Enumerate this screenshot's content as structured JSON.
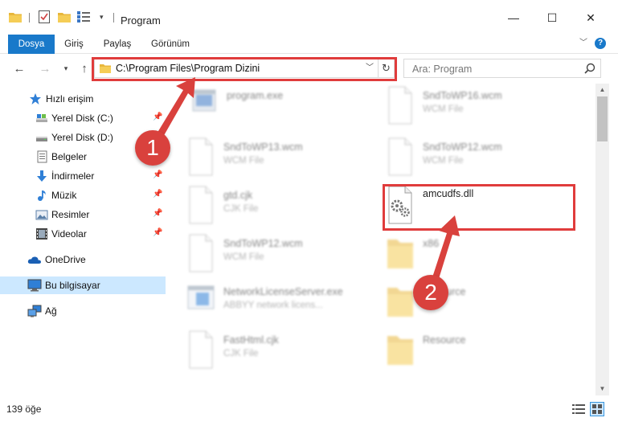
{
  "window": {
    "title": "Program",
    "minimize_glyph": "—",
    "maximize_glyph": "☐",
    "close_glyph": "✕"
  },
  "ribbon": {
    "tabs": [
      "Dosya",
      "Giriş",
      "Paylaş",
      "Görünüm"
    ],
    "help_glyph": "?"
  },
  "nav": {
    "address": "C:\\Program Files\\Program Dizini",
    "search_placeholder": "Ara: Program"
  },
  "sidebar": {
    "items": [
      {
        "label": "Hızlı erişim",
        "icon": "star-icon",
        "pinned": false
      },
      {
        "label": "Yerel Disk (C:)",
        "icon": "drive-icon",
        "pinned": true
      },
      {
        "label": "Yerel Disk (D:)",
        "icon": "drive-icon",
        "pinned": true
      },
      {
        "label": "Belgeler",
        "icon": "document-icon",
        "pinned": true
      },
      {
        "label": "İndirmeler",
        "icon": "download-icon",
        "pinned": true
      },
      {
        "label": "Müzik",
        "icon": "music-icon",
        "pinned": true
      },
      {
        "label": "Resimler",
        "icon": "picture-icon",
        "pinned": true
      },
      {
        "label": "Videolar",
        "icon": "video-icon",
        "pinned": true
      },
      {
        "label": "OneDrive",
        "icon": "cloud-icon",
        "pinned": false
      },
      {
        "label": "Bu bilgisayar",
        "icon": "computer-icon",
        "pinned": false
      },
      {
        "label": "Ağ",
        "icon": "network-icon",
        "pinned": false
      }
    ]
  },
  "files": [
    {
      "name": "program.exe",
      "type": "",
      "icon": "exe-icon"
    },
    {
      "name": "SndToWP16.wcm",
      "type": "WCM File",
      "icon": "file-icon"
    },
    {
      "name": "SndToWP13.wcm",
      "type": "WCM File",
      "icon": "file-icon"
    },
    {
      "name": "SndToWP12.wcm",
      "type": "WCM File",
      "icon": "file-icon"
    },
    {
      "name": "gtd.cjk",
      "type": "CJK File",
      "icon": "file-icon"
    },
    {
      "name": "amcudfs.dll",
      "type": "",
      "icon": "dll-gear-icon"
    },
    {
      "name": "SndToWP12.wcm",
      "type": "WCM File",
      "icon": "file-icon"
    },
    {
      "name": "x86",
      "type": "",
      "icon": "folder-icon"
    },
    {
      "name": "NetworkLicenseServer.exe",
      "type": "ABBYY network licens...",
      "icon": "exe-icon"
    },
    {
      "name": "Resource",
      "type": "",
      "icon": "folder-icon"
    },
    {
      "name": "FastHtml.cjk",
      "type": "CJK File",
      "icon": "file-icon"
    },
    {
      "name": "Resource",
      "type": "",
      "icon": "folder-icon"
    }
  ],
  "status": {
    "count": "139 öğe"
  },
  "annotations": {
    "marker_1": "1",
    "marker_2": "2",
    "highlight_color": "#e03c3c",
    "marker_color": "#d9413d"
  }
}
